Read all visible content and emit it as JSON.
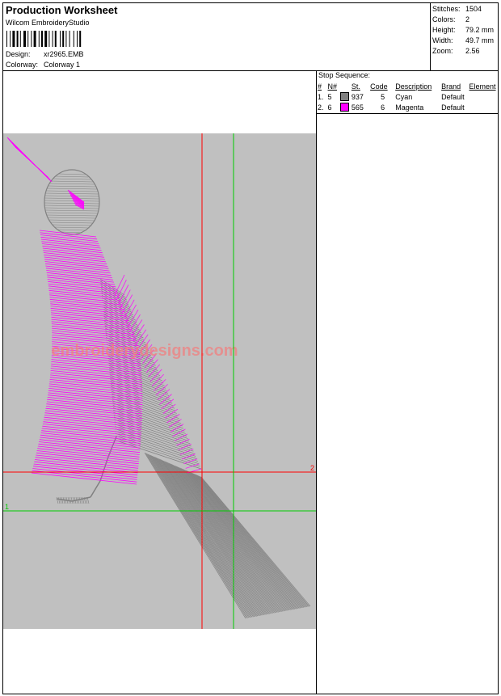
{
  "header": {
    "title": "Production Worksheet",
    "software": "Wilcom EmbroideryStudio",
    "design_label": "Design:",
    "design_value": "xr2965.EMB",
    "colorway_label": "Colorway:",
    "colorway_value": "Colorway 1"
  },
  "stats": {
    "stitches_label": "Stitches:",
    "stitches_value": "1504",
    "colors_label": "Colors:",
    "colors_value": "2",
    "height_label": "Height:",
    "height_value": "79.2 mm",
    "width_label": "Width:",
    "width_value": "49.7 mm",
    "zoom_label": "Zoom:",
    "zoom_value": "2.56"
  },
  "stop_sequence": {
    "title": "Stop Sequence:",
    "headers": {
      "num": "#",
      "n": "N#",
      "st": "St.",
      "code": "Code",
      "description": "Description",
      "brand": "Brand",
      "element": "Element"
    },
    "rows": [
      {
        "num": "1.",
        "n": "5",
        "swatch": "#808080",
        "st": "937",
        "code": "5",
        "description": "Cyan",
        "brand": "Default",
        "element": ""
      },
      {
        "num": "2.",
        "n": "6",
        "swatch": "#ff00ff",
        "st": "565",
        "code": "6",
        "description": "Magenta",
        "brand": "Default",
        "element": ""
      }
    ]
  },
  "canvas": {
    "background": "#c0c0c0",
    "watermark": "embroiderydesigns.com",
    "guide_red_label": "2",
    "guide_green_label": "1",
    "thread_colors": [
      "#808080",
      "#ff00ff"
    ]
  }
}
